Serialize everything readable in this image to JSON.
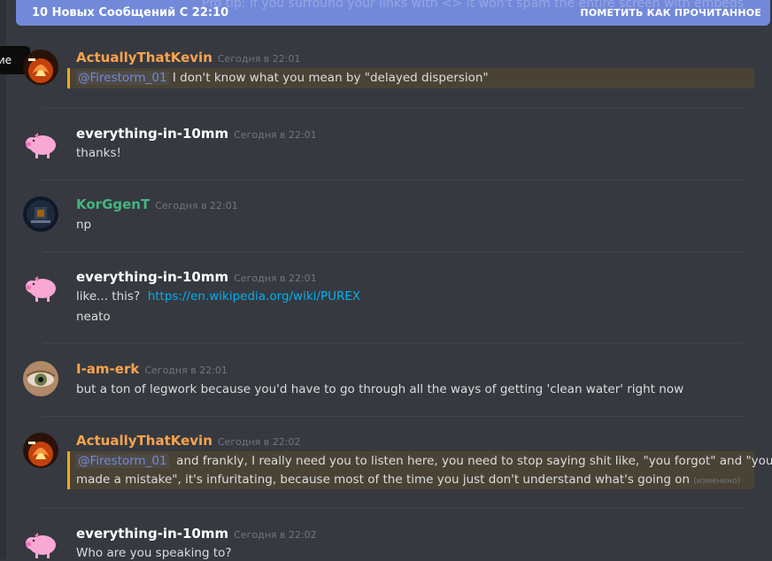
{
  "new_messages_bar": {
    "count_text": "10 Новых Сообщений С 22:10",
    "mark_read_label": "ПОМЕТИТЬ КАК ПРОЧИТАННОЕ",
    "behind_text": "Pro tip: if you surround your links with <> it won't spam the entire screen with embeds"
  },
  "tooltip": {
    "text": "ние"
  },
  "messages": [
    {
      "author": "ActuallyThatKevin",
      "timestamp": "Сегодня в 22:01",
      "color": "#fba34d",
      "avatar": "fire-avatar",
      "mention": "@Firestorm_01",
      "text": "I don't know what you mean by \"delayed dispersion\""
    },
    {
      "author": "everything-in-10mm",
      "timestamp": "Сегодня в 22:01",
      "color": "#ffffff",
      "avatar": "pig-avatar",
      "text": "thanks!"
    },
    {
      "author": "KorGgenT",
      "timestamp": "Сегодня в 22:01",
      "color": "#43b581",
      "avatar": "dark-avatar",
      "text": "np"
    },
    {
      "author": "everything-in-10mm",
      "timestamp": "Сегодня в 22:01",
      "color": "#ffffff",
      "avatar": "pig-avatar",
      "prefix": "like... this?",
      "link": "https://en.wikipedia.org/wiki/PUREX",
      "text2": "neato"
    },
    {
      "author": "I-am-erk",
      "timestamp": "Сегодня в 22:01",
      "color": "#fba34d",
      "avatar": "eye-avatar",
      "text": "but a ton of legwork because you'd have to go through all the ways of getting 'clean water' right now"
    },
    {
      "author": "ActuallyThatKevin",
      "timestamp": "Сегодня в 22:02",
      "color": "#fba34d",
      "avatar": "fire-avatar",
      "mention": "@Firestorm_01",
      "text": "and frankly, I really need you to listen here, you need to stop saying shit like, \"you forgot\" and \"you",
      "text2": "made a mistake\", it's infuritating, because most of the time you just don't understand what's going on",
      "edited": "(изменено)"
    },
    {
      "author": "everything-in-10mm",
      "timestamp": "Сегодня в 22:02",
      "color": "#ffffff",
      "avatar": "pig-avatar",
      "text": "Who are you speaking to?"
    }
  ]
}
